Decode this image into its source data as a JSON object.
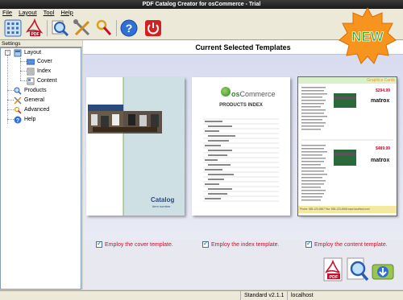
{
  "window": {
    "title": "PDF Catalog Creator for osCommerce - Trial"
  },
  "menu": {
    "items": [
      "File",
      "Layout",
      "Tool",
      "Help"
    ]
  },
  "badge": {
    "label": "NEW"
  },
  "sidebar": {
    "header": "Settings",
    "tree": [
      {
        "label": "Layout"
      },
      {
        "label": "Cover"
      },
      {
        "label": "Index"
      },
      {
        "label": "Content"
      },
      {
        "label": "Products"
      },
      {
        "label": "General"
      },
      {
        "label": "Advanced"
      },
      {
        "label": "Help"
      }
    ]
  },
  "main": {
    "title": "Current Selected Templates",
    "cover": {
      "catalog_label": "Catalog",
      "catalog_sub": "Item number"
    },
    "index": {
      "brand_os": "os",
      "brand_commerce": "Commerce",
      "heading": "PRODUCTS INDEX"
    },
    "content": {
      "header_text": "Graphics Cards",
      "price1": "$294.99",
      "price2": "$489.99",
      "brand": "matrox",
      "footer": "Phone: 555-123-4567  Fax: 555-123-4568  www.localhost.com"
    },
    "options": [
      {
        "label": "Employ the cover template.",
        "checked": true
      },
      {
        "label": "Employ the index template.",
        "checked": true
      },
      {
        "label": "Employ the content template.",
        "checked": true
      }
    ]
  },
  "status": {
    "version": "Standard v2.1.1",
    "host": "localhost"
  }
}
